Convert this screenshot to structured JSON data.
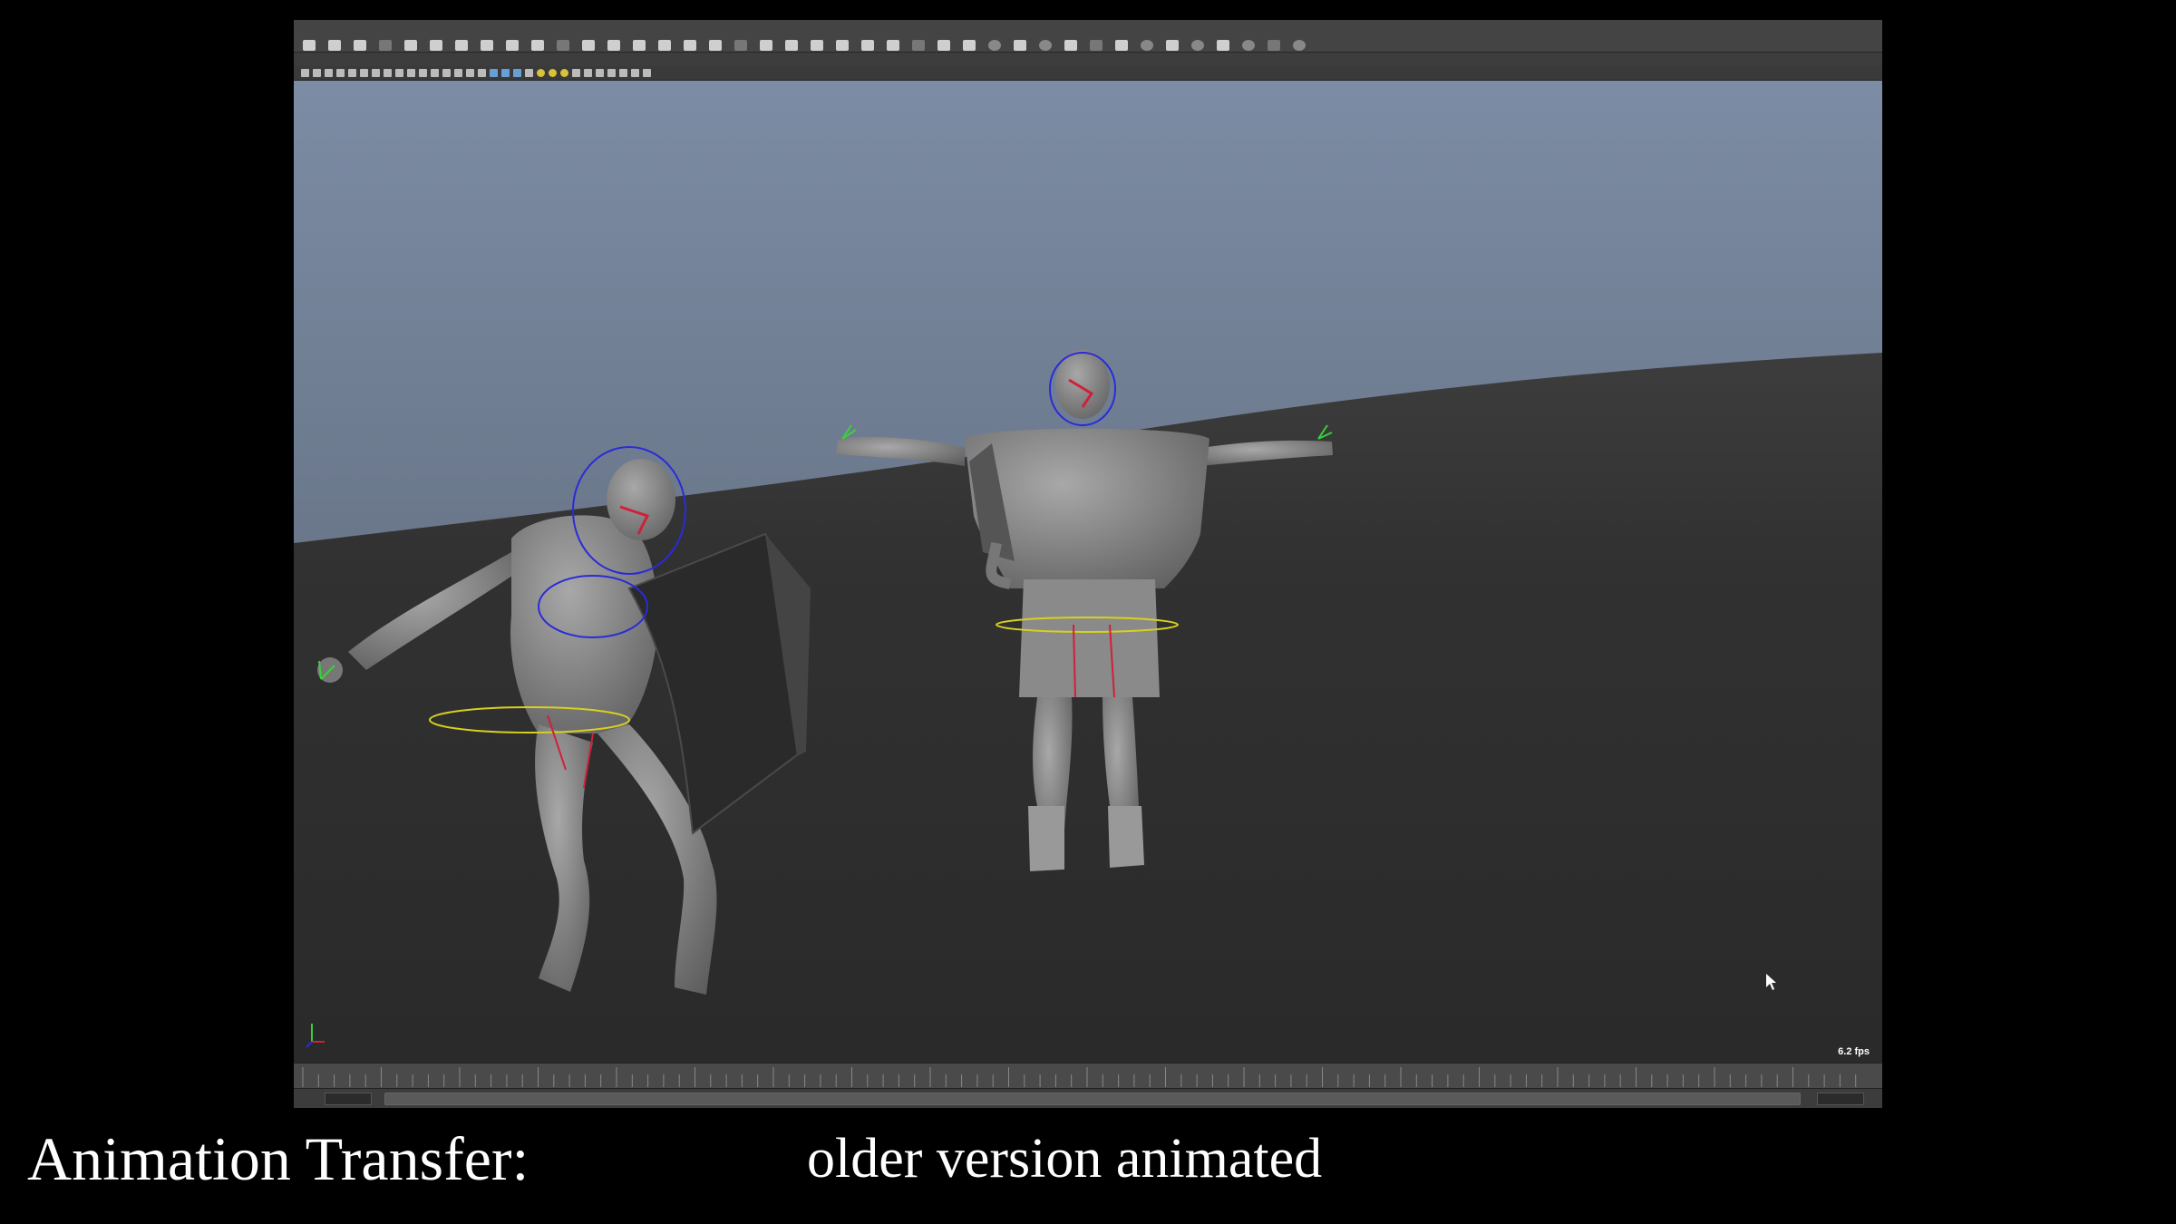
{
  "caption": {
    "left": "Animation Transfer:",
    "right": "older version animated"
  },
  "viewport": {
    "fps": "6.2 fps"
  },
  "colors": {
    "sky_top": "#7b8ba3",
    "sky_bottom": "#5a6577",
    "ground": "#2e2e2e",
    "rig_blue": "#2b2bd8",
    "rig_red": "#d0203a",
    "rig_yellow": "#d8d020",
    "rig_green": "#3ad03a"
  },
  "shelf": {
    "icons": [
      "shelf-tool-icon",
      "shelf-tool-icon",
      "shelf-tool-icon",
      "shelf-tool-icon",
      "shelf-tool-icon",
      "shelf-tool-icon",
      "shelf-tool-icon",
      "shelf-tool-icon",
      "shelf-tool-icon",
      "shelf-tool-icon",
      "shelf-tool-icon",
      "shelf-tool-icon",
      "shelf-tool-icon",
      "shelf-tool-icon",
      "shelf-tool-icon",
      "shelf-tool-icon",
      "shelf-tool-icon",
      "shelf-tool-icon",
      "shelf-tool-icon",
      "shelf-tool-icon",
      "shelf-tool-icon",
      "shelf-tool-icon",
      "shelf-tool-icon",
      "shelf-tool-icon",
      "shelf-tool-icon",
      "shelf-tool-icon",
      "shelf-tool-icon",
      "shelf-tool-icon",
      "shelf-tool-icon",
      "shelf-tool-icon",
      "shelf-tool-icon",
      "shelf-tool-icon",
      "shelf-tool-icon",
      "shelf-tool-icon",
      "shelf-tool-icon",
      "shelf-tool-icon",
      "shelf-tool-icon",
      "shelf-tool-icon",
      "shelf-tool-icon",
      "shelf-tool-icon"
    ]
  }
}
